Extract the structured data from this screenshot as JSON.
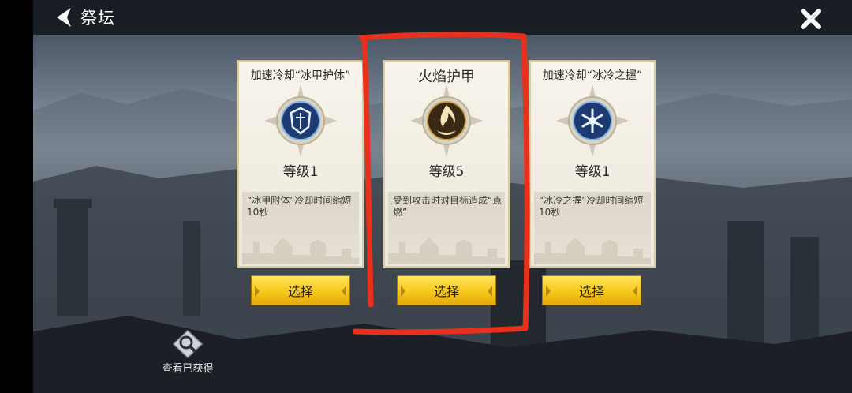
{
  "header": {
    "back_icon": "back-chevron-icon",
    "title": "祭坛",
    "close_icon": "close-x-icon"
  },
  "cards": [
    {
      "title": "加速冷却“冰甲护体”",
      "emblem_icon": "ice-armor-shield-icon",
      "level": "等级1",
      "description": "“冰甲附体”冷却时间缩短10秒",
      "button": "选择",
      "accent": "#2c4e8c"
    },
    {
      "title": "火焰护甲",
      "emblem_icon": "flame-icon",
      "level": "等级5",
      "description": "受到攻击时对目标造成“点燃”",
      "button": "选择",
      "accent": "#8a5a1c"
    },
    {
      "title": "加速冷却“冰冷之握”",
      "emblem_icon": "snowflake-icon",
      "level": "等级1",
      "description": "“冰冷之握”冷却时间缩短10秒",
      "button": "选择",
      "accent": "#2c4e8c"
    }
  ],
  "footer": {
    "view_icon": "magnifier-icon",
    "view_label": "查看已获得"
  },
  "annotation": {
    "color": "#e8301c"
  }
}
